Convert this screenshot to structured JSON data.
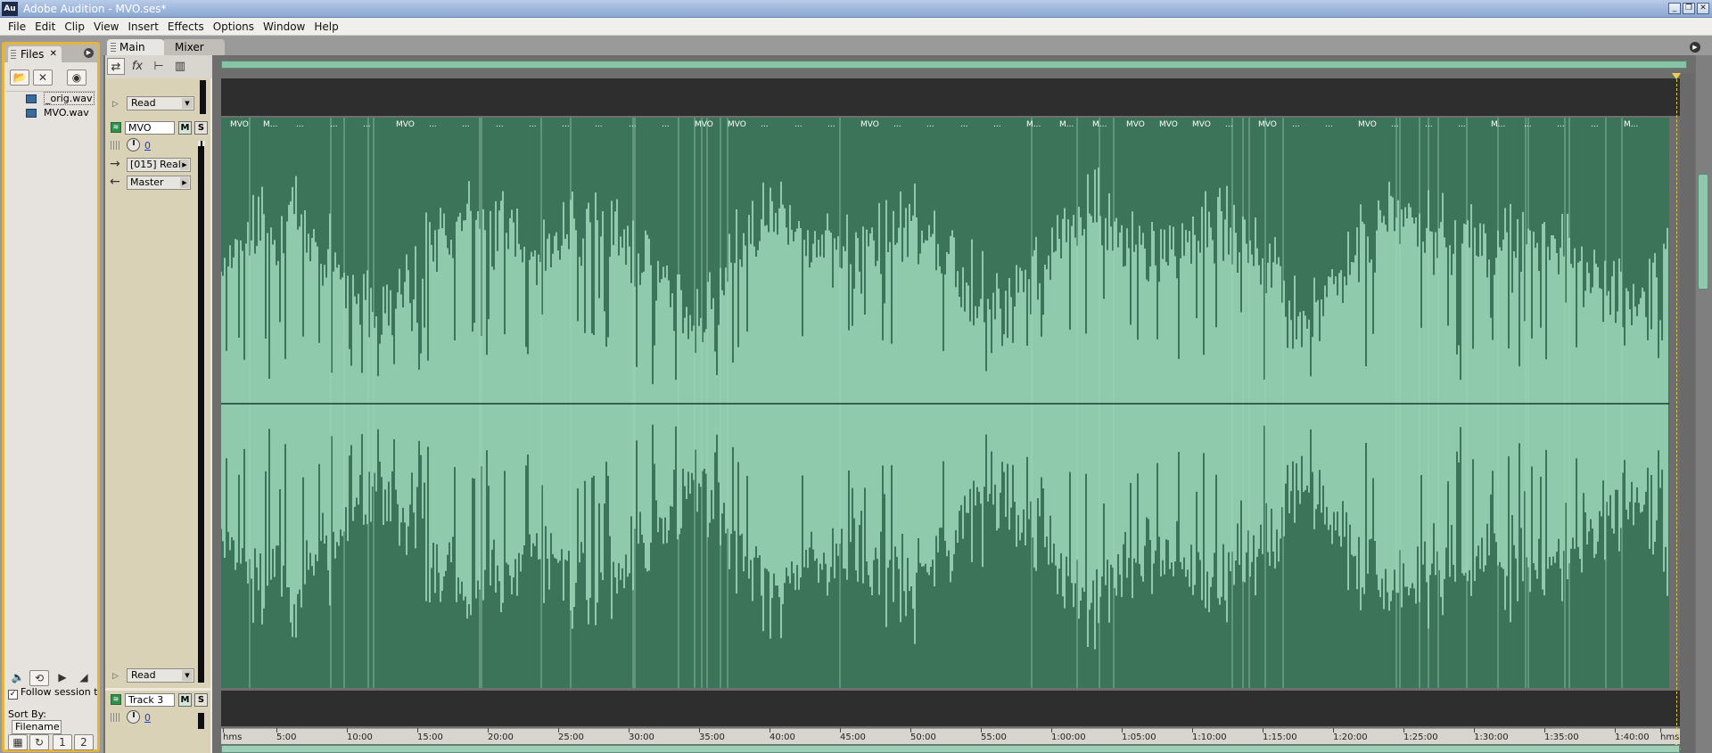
{
  "window": {
    "app_icon": "Au",
    "title": "Adobe Audition - MVO.ses*"
  },
  "menu": [
    "File",
    "Edit",
    "Clip",
    "View",
    "Insert",
    "Effects",
    "Options",
    "Window",
    "Help"
  ],
  "files_panel": {
    "tab_label": "Files",
    "files": [
      "_orig.wav",
      "MVO.wav"
    ],
    "follow_label": "Follow session tem",
    "follow_checked": true,
    "sort_label": "Sort By:",
    "sort_value": "Filename"
  },
  "main_tabs": [
    "Main",
    "Mixer"
  ],
  "automation": {
    "mode_top": "Read",
    "mode_bottom": "Read"
  },
  "tracks": [
    {
      "name": "MVO",
      "mute": "M",
      "solo": "S",
      "volume": "0",
      "input": "[015] Real",
      "output": "Master"
    },
    {
      "name": "Track 3",
      "mute": "M",
      "solo": "S",
      "volume": "0"
    }
  ],
  "clips": [
    "MVO",
    "M...",
    "...",
    "...",
    "...",
    "MVO",
    "...",
    "...",
    "...",
    "...",
    "...",
    "...",
    "...",
    "...",
    "MVO",
    "MVO",
    "...",
    "...",
    "...",
    "MVO",
    "...",
    "...",
    "...",
    "...",
    "M...",
    "M...",
    "M...",
    "MVO",
    "MVO",
    "MVO",
    "...",
    "MVO",
    "...",
    "...",
    "MVO",
    "...",
    "...",
    "...",
    "M...",
    "...",
    "...",
    "...",
    "M..."
  ],
  "ruler": {
    "start": "hms",
    "ticks": [
      "5:00",
      "10:00",
      "15:00",
      "20:00",
      "25:00",
      "30:00",
      "35:00",
      "40:00",
      "45:00",
      "50:00",
      "55:00",
      "1:00:00",
      "1:05:00",
      "1:10:00",
      "1:15:00",
      "1:20:00",
      "1:25:00",
      "1:30:00",
      "1:35:00",
      "1:40:00"
    ],
    "end": "hms"
  },
  "colors": {
    "wave_bg": "#3c7459",
    "wave_fg": "#8ecaab",
    "accent": "#e7b43a"
  }
}
